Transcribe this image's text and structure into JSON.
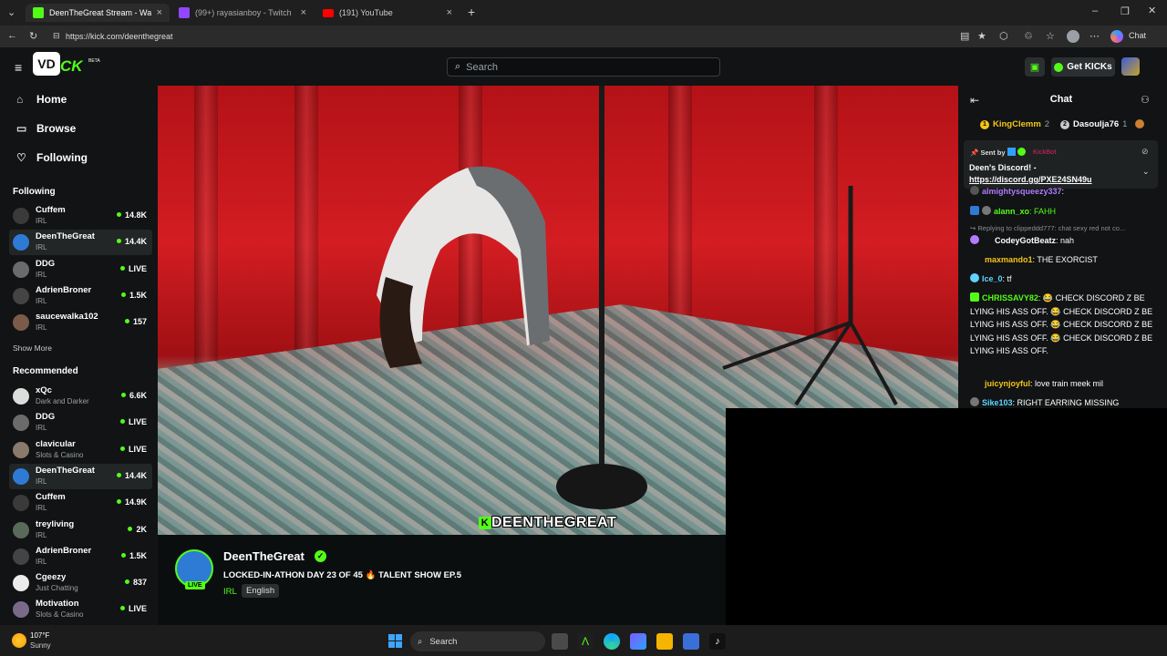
{
  "browser": {
    "tabs": [
      {
        "title": "DeenTheGreat Stream - Watch",
        "active": true
      },
      {
        "title": "(99+) rayasianboy - Twitch",
        "active": false
      },
      {
        "title": "(191) YouTube",
        "active": false
      }
    ],
    "url": "https://kick.com/deenthegreat",
    "chat_label": "Chat"
  },
  "header": {
    "search_placeholder": "Search",
    "get_kicks": "Get KICKs"
  },
  "sidebar": {
    "nav": [
      {
        "label": "Home",
        "icon": "home-icon"
      },
      {
        "label": "Browse",
        "icon": "browse-icon"
      },
      {
        "label": "Following",
        "icon": "heart-icon"
      }
    ],
    "following_title": "Following",
    "following": [
      {
        "name": "Cuffem",
        "category": "IRL",
        "viewers": "14.8K",
        "color": "#3a3a3a"
      },
      {
        "name": "DeenTheGreat",
        "category": "IRL",
        "viewers": "14.4K",
        "color": "#2e7bd6",
        "selected": true
      },
      {
        "name": "DDG",
        "category": "IRL",
        "viewers": "LIVE",
        "color": "#6b6b6b"
      },
      {
        "name": "AdrienBroner",
        "category": "IRL",
        "viewers": "1.5K",
        "color": "#444"
      },
      {
        "name": "saucewalka102",
        "category": "IRL",
        "viewers": "157",
        "color": "#7a5a4a"
      }
    ],
    "show_more": "Show More",
    "recommended_title": "Recommended",
    "recommended": [
      {
        "name": "xQc",
        "category": "Dark and Darker",
        "viewers": "6.6K",
        "color": "#dcdcdc"
      },
      {
        "name": "DDG",
        "category": "IRL",
        "viewers": "LIVE",
        "color": "#6b6b6b"
      },
      {
        "name": "clavicular",
        "category": "Slots & Casino",
        "viewers": "LIVE",
        "color": "#8a7a6a"
      },
      {
        "name": "DeenTheGreat",
        "category": "IRL",
        "viewers": "14.4K",
        "color": "#2e7bd6",
        "selected": true
      },
      {
        "name": "Cuffem",
        "category": "IRL",
        "viewers": "14.9K",
        "color": "#3a3a3a"
      },
      {
        "name": "treyliving",
        "category": "IRL",
        "viewers": "2K",
        "color": "#5a6a5a"
      },
      {
        "name": "AdrienBroner",
        "category": "IRL",
        "viewers": "1.5K",
        "color": "#444"
      },
      {
        "name": "Cgeezy",
        "category": "Just Chatting",
        "viewers": "837",
        "color": "#ececec"
      },
      {
        "name": "Motivation",
        "category": "Slots & Casino",
        "viewers": "LIVE",
        "color": "#7a6a8a"
      }
    ]
  },
  "video": {
    "watermark": "DEENTHEGREAT"
  },
  "stream": {
    "name": "DeenTheGreat",
    "live": "LIVE",
    "title": "LOCKED-IN-ATHON DAY 23 OF 45 🔥 TALENT SHOW EP.5",
    "category": "IRL",
    "language": "English"
  },
  "chat": {
    "title": "Chat",
    "gifters": [
      {
        "name": "KingClemm",
        "count": "2",
        "badge": "1",
        "color": "#f5c518"
      },
      {
        "name": "Dasoulja76",
        "count": "1",
        "badge": "2",
        "color": "#c9c9c9"
      }
    ],
    "pinned": {
      "sent_by": "Sent by",
      "sender": "KickBot",
      "text": "Deen's Discord! -",
      "link": "https://discord.gg/PXE24SN49u"
    },
    "reply_context": "Replying to clippeddd777: chat sexy red not co...",
    "messages": [
      {
        "user": "almightysqueezy337",
        "text": ":",
        "color": "#b17cff"
      },
      {
        "user": "alann_xo",
        "text": ": FAHH",
        "color": "#53fc18"
      },
      {
        "user": "CodeyGotBeatz",
        "text": ": nah",
        "color": "#ffffff"
      },
      {
        "user": "maxmando1",
        "text": ": THE EXORCIST",
        "color": "#f5c518"
      },
      {
        "user": "Ice_0",
        "text": ": tf",
        "color": "#5fd3ff"
      },
      {
        "user": "CHRISSAVY82",
        "text": ": 😂 CHECK DISCORD Z BE LYING HIS ASS OFF. 😂 CHECK DISCORD Z BE LYING HIS ASS OFF. 😂 CHECK DISCORD Z BE LYING HIS ASS OFF. 😂 CHECK DISCORD Z BE LYING HIS ASS OFF.",
        "color": "#53fc18"
      },
      {
        "user": "juicynjoyful",
        "text": ": love train meek mil",
        "color": "#f5c518"
      },
      {
        "user": "Sike103",
        "text": ": RIGHT EARRING MISSING",
        "color": "#5fd3ff"
      }
    ]
  },
  "taskbar": {
    "temp": "107°F",
    "weather": "Sunny",
    "search": "Search"
  }
}
